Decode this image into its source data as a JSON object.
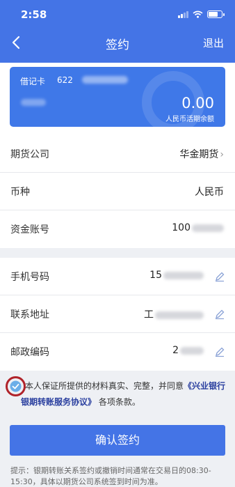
{
  "status_bar": {
    "time": "2:58"
  },
  "nav": {
    "title": "签约",
    "logout_label": "退出"
  },
  "card": {
    "type": "借记卡",
    "number_prefix": "622",
    "balance": "0.00",
    "balance_label": "人民币活期余额"
  },
  "fields": {
    "company": {
      "label": "期货公司",
      "value": "华金期货"
    },
    "currency": {
      "label": "币种",
      "value": "人民币"
    },
    "account": {
      "label": "资金账号",
      "value": "100"
    },
    "phone": {
      "label": "手机号码",
      "value": "15"
    },
    "address": {
      "label": "联系地址",
      "value": "工"
    },
    "postcode": {
      "label": "邮政编码",
      "value": "2"
    }
  },
  "agreement": {
    "text": "本人保证所提供的材料真实、完整，并同意",
    "link": "《兴业银行银期转账服务协议》",
    "suffix": "各项条款。"
  },
  "confirm_label": "确认签约",
  "tip": "提示：银期转账关系签约或撤销时间通常在交易日的08:30-15:30，具体以期货公司系统签到时间为准。",
  "colors": {
    "primary": "#4474e6",
    "link": "#2a3f9f",
    "check_highlight": "#b0232a"
  }
}
